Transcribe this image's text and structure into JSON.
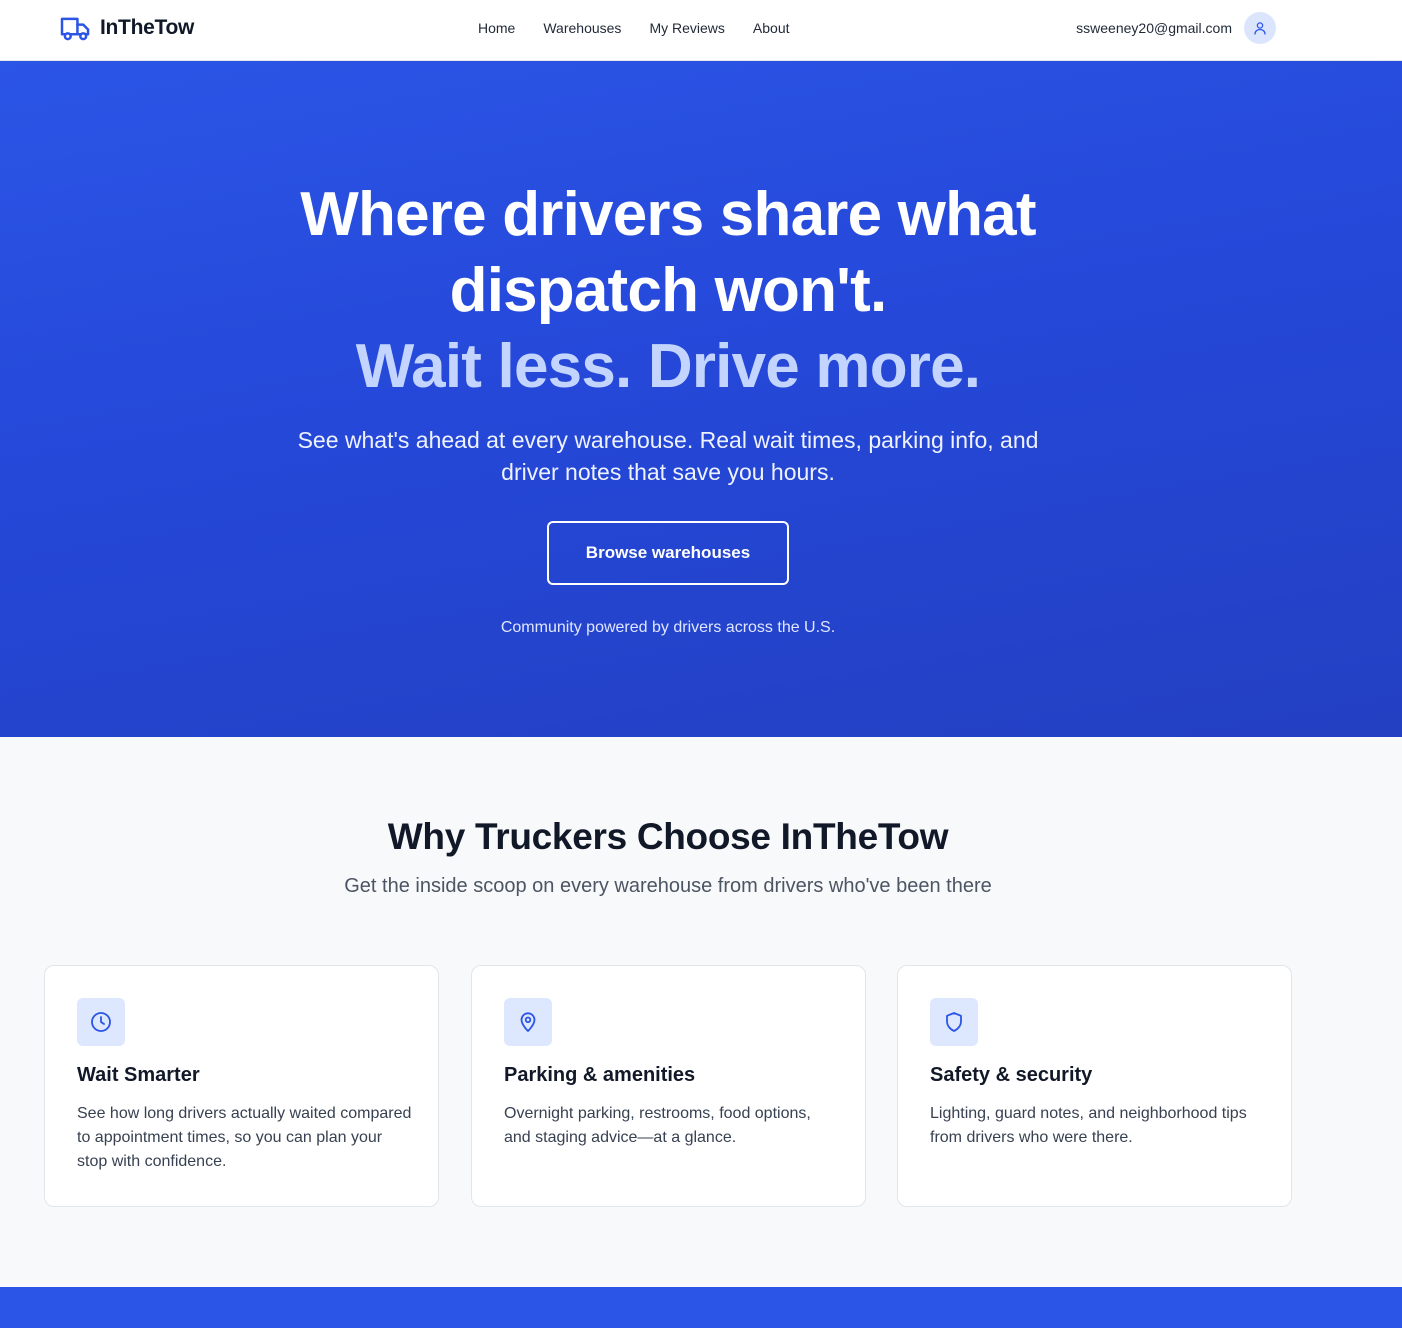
{
  "nav": {
    "brand": "InTheTow",
    "links": [
      "Home",
      "Warehouses",
      "My Reviews",
      "About"
    ],
    "user_email": "ssweeney20@gmail.com"
  },
  "hero": {
    "title_line1": "Where drivers share what",
    "title_line2": "dispatch won't.",
    "title_accent": "Wait less. Drive more.",
    "subtitle": "See what's ahead at every warehouse. Real wait times, parking info, and driver notes that save you hours.",
    "cta_label": "Browse warehouses",
    "note": "Community powered by drivers across the U.S."
  },
  "features": {
    "title": "Why Truckers Choose InTheTow",
    "subtitle": "Get the inside scoop on every warehouse from drivers who've been there",
    "cards": [
      {
        "icon": "clock-icon",
        "title": "Wait Smarter",
        "text": "See how long drivers actually waited compared to appointment times, so you can plan your stop with confidence."
      },
      {
        "icon": "map-pin-icon",
        "title": "Parking & amenities",
        "text": "Overnight parking, restrooms, food options, and staging advice—at a glance."
      },
      {
        "icon": "shield-icon",
        "title": "Safety & security",
        "text": "Lighting, guard notes, and neighborhood tips from drivers who were there."
      }
    ]
  },
  "colors": {
    "brand_blue": "#2b55e6",
    "accent_text": "#c3d5ff",
    "icon_bg": "#dde7fd"
  }
}
